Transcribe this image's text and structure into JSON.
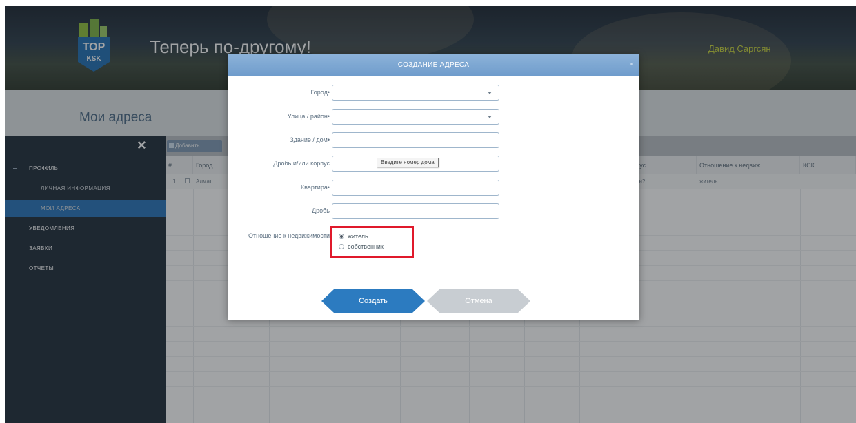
{
  "header": {
    "logo_text_top": "TOP",
    "logo_text_bottom": "KSK",
    "app_title": "Теперь по-другому!",
    "user_name": "Давид Саргсян"
  },
  "page": {
    "title": "Мои адреса"
  },
  "sidebar": {
    "close_icon": "×",
    "items": [
      {
        "label": "Профиль"
      },
      {
        "label": "Личная информация"
      },
      {
        "label": "Мои адреса"
      },
      {
        "label": "Уведомления"
      },
      {
        "label": "Заявки"
      },
      {
        "label": "Отчеты"
      }
    ]
  },
  "grid": {
    "add_label": "Добавить",
    "columns": [
      "#",
      "Город",
      "…тус",
      "Отношение к недвиж.",
      "КСК"
    ],
    "row": {
      "num": "1",
      "city": "Алмат",
      "status": "…ен?",
      "relation": "житель"
    }
  },
  "modal": {
    "title": "СОЗДАНИЕ АДРЕСА",
    "close_icon": "×",
    "fields": {
      "city_label": "Город",
      "street_label": "Улица / район",
      "building_label": "Здание / дом",
      "fraction_corpus_label": "Дробь и/или корпус",
      "apartment_label": "Квартира",
      "fraction_label": "Дробь",
      "relation_label": "Отношение к недвижимости",
      "required_mark": "•"
    },
    "tooltip": "Введите номер дома",
    "relation_options": [
      {
        "label": "житель",
        "checked": true
      },
      {
        "label": "собственник",
        "checked": false
      }
    ],
    "buttons": {
      "create": "Создать",
      "cancel": "Отмена"
    }
  },
  "colors": {
    "accent": "#2c7bc0",
    "highlight": "#e0192b",
    "sidebar": "#1e2b38",
    "user_name": "#c8d43a"
  }
}
